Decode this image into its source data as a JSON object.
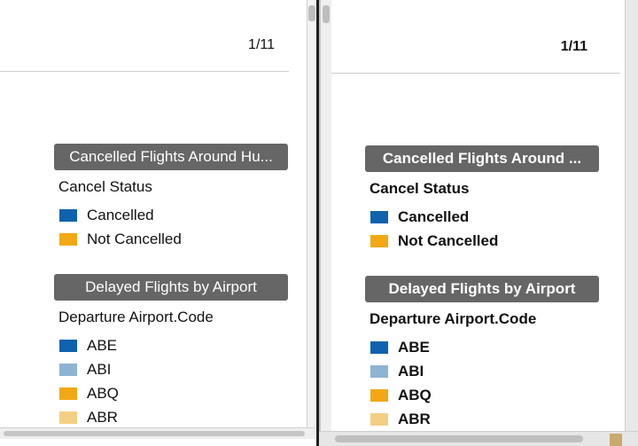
{
  "left": {
    "page_indicator": "1/11",
    "legend_cancelled": {
      "title": "Cancelled Flights Around Hu...",
      "field": "Cancel Status",
      "items": [
        {
          "label": "Cancelled",
          "color": "#0f62ad"
        },
        {
          "label": "Not Cancelled",
          "color": "#f2a814"
        }
      ]
    },
    "legend_delayed": {
      "title": "Delayed Flights by Airport",
      "field": "Departure Airport.Code",
      "items": [
        {
          "label": "ABE",
          "color": "#0f62ad"
        },
        {
          "label": "ABI",
          "color": "#8db4d2"
        },
        {
          "label": "ABQ",
          "color": "#f2a814"
        },
        {
          "label": "ABR",
          "color": "#f3cf83"
        }
      ]
    }
  },
  "right": {
    "page_indicator": "1/11",
    "legend_cancelled": {
      "title": "Cancelled Flights Around ...",
      "field": "Cancel Status",
      "items": [
        {
          "label": "Cancelled",
          "color": "#0f62ad"
        },
        {
          "label": "Not Cancelled",
          "color": "#f2a814"
        }
      ]
    },
    "legend_delayed": {
      "title": "Delayed Flights by Airport",
      "field": "Departure Airport.Code",
      "items": [
        {
          "label": "ABE",
          "color": "#0f62ad"
        },
        {
          "label": "ABI",
          "color": "#8db4d2"
        },
        {
          "label": "ABQ",
          "color": "#f2a814"
        },
        {
          "label": "ABR",
          "color": "#f3cf83"
        }
      ]
    }
  }
}
